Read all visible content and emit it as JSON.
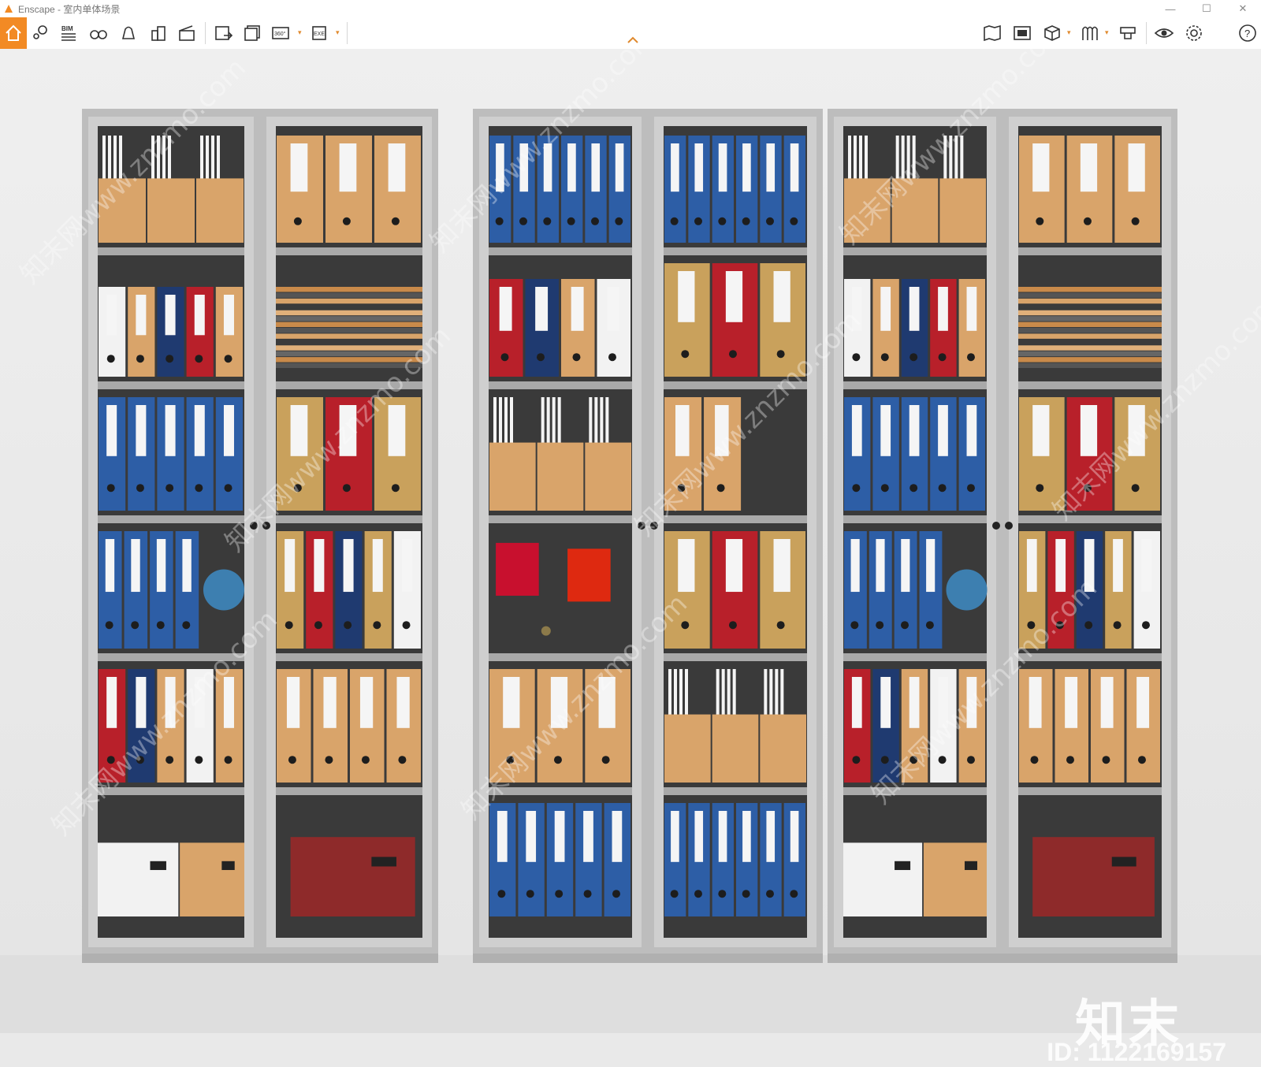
{
  "window": {
    "title": "Enscape - 室内单体场景",
    "minimize": "—",
    "maximize": "☐",
    "close": "✕"
  },
  "toolbar": {
    "left_icons": [
      "home-icon",
      "map-pin-icon",
      "bim-icon",
      "binoculars-icon",
      "bell-icon",
      "buildings-icon",
      "clapperboard-icon",
      "screenshot-icon",
      "batch-render-icon",
      "360-panorama-icon",
      "exe-export-icon"
    ],
    "bim_label": "BIM",
    "pano_label": "360°",
    "exe_label": "EXE",
    "right_icons": [
      "map-icon",
      "asset-library-icon",
      "cube-icon",
      "material-icon",
      "atmosphere-icon",
      "eye-icon",
      "gear-icon",
      "help-icon"
    ]
  },
  "watermark": {
    "brand": "知末",
    "id": "ID: 1122169157",
    "diagonal": "知末网www.znzmo.com"
  },
  "colors": {
    "accent": "#f28a24",
    "wall": "#e9e9e9",
    "frame": "#c8c8c8",
    "blue": "#2d5ea6",
    "red": "#b8202a",
    "kraft": "#d9a46a",
    "white": "#f2f2f2"
  }
}
